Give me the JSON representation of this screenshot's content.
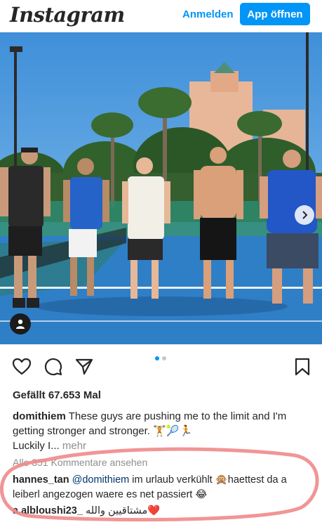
{
  "header": {
    "logo_text": "Instagram",
    "login_label": "Anmelden",
    "open_app_label": "App öffnen",
    "accent_color": "#0095f6"
  },
  "post": {
    "carousel": {
      "total": 2,
      "current": 1
    },
    "likes_text": "Gefällt 67.653 Mal",
    "caption": {
      "username": "domithiem",
      "text": "These guys are pushing me to the limit and I'm getting stronger and stronger. 🏋🎾🏃",
      "continuation": "Luckily I...",
      "more_label": "mehr"
    },
    "view_all_comments": "Alle 351 Kommentare ansehen",
    "comments": [
      {
        "username": "hannes_tan",
        "mention": "@domithiem",
        "text_before": "im urlaub verkühlt 🙊",
        "text_after": "haettest da a leiberl angezogen waere es net passiert 😂"
      },
      {
        "username": "a.albloushi23_",
        "text": "مشتاقيين والله❤️"
      }
    ]
  },
  "icons": {
    "like": "heart-icon",
    "comment": "comment-icon",
    "share": "send-icon",
    "save": "bookmark-icon",
    "tag": "user-tag-icon",
    "next": "chevron-right-icon"
  },
  "annotation_color": "#f08a8a"
}
